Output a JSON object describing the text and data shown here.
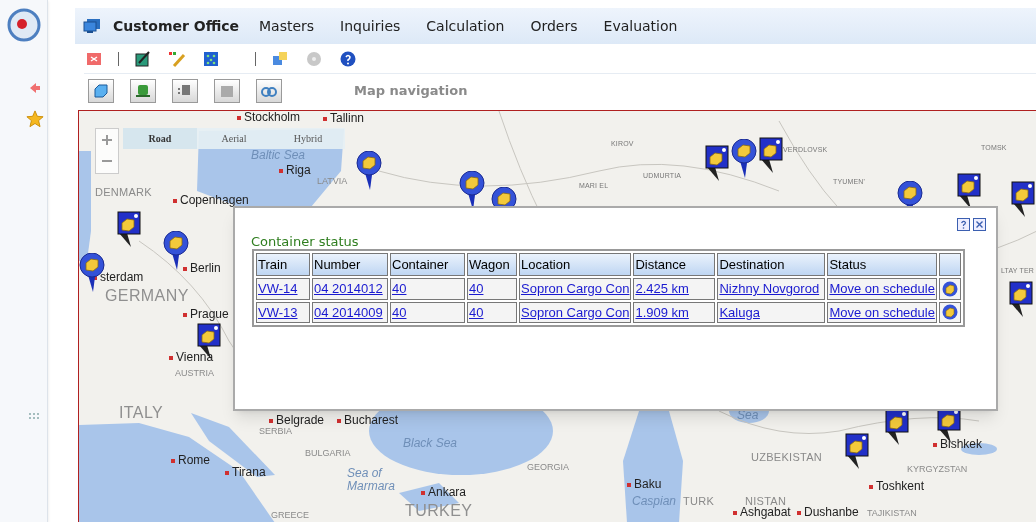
{
  "app": {
    "title": "Customer Office"
  },
  "menu": [
    {
      "label": "Masters"
    },
    {
      "label": "Inquiries"
    },
    {
      "label": "Calculation"
    },
    {
      "label": "Orders"
    },
    {
      "label": "Evaluation"
    }
  ],
  "section_title": "Map navigation",
  "map": {
    "view_modes": [
      {
        "label": "Road",
        "selected": true
      },
      {
        "label": "Aerial",
        "selected": false
      },
      {
        "label": "Hybrid",
        "selected": false
      }
    ],
    "labels": [
      {
        "text": "Stockholm",
        "kind": "city"
      },
      {
        "text": "Tallinn",
        "kind": "city"
      },
      {
        "text": "Baltic Sea",
        "kind": "sea"
      },
      {
        "text": "Riga",
        "kind": "city"
      },
      {
        "text": "LATVIA",
        "kind": "country_small"
      },
      {
        "text": "DENMARK",
        "kind": "country"
      },
      {
        "text": "Copenhagen",
        "kind": "city"
      },
      {
        "text": "sterdam",
        "kind": "city"
      },
      {
        "text": "Berlin",
        "kind": "city"
      },
      {
        "text": "GERMANY",
        "kind": "country_large"
      },
      {
        "text": "Prague",
        "kind": "city"
      },
      {
        "text": "Vienna",
        "kind": "city"
      },
      {
        "text": "AUSTRIA",
        "kind": "country_small"
      },
      {
        "text": "ITALY",
        "kind": "country_large"
      },
      {
        "text": "Belgrade",
        "kind": "city"
      },
      {
        "text": "Bucharest",
        "kind": "city"
      },
      {
        "text": "SERBIA",
        "kind": "country_small"
      },
      {
        "text": "BULGARIA",
        "kind": "country_small"
      },
      {
        "text": "Black Sea",
        "kind": "sea"
      },
      {
        "text": "Rome",
        "kind": "city"
      },
      {
        "text": "Tirana",
        "kind": "city"
      },
      {
        "text": "Sea of Marmara",
        "kind": "sea"
      },
      {
        "text": "Ankara",
        "kind": "city"
      },
      {
        "text": "GREECE",
        "kind": "country_small"
      },
      {
        "text": "TURKEY",
        "kind": "country_large"
      },
      {
        "text": "GEORGIA",
        "kind": "country_small"
      },
      {
        "text": "Baku",
        "kind": "city"
      },
      {
        "text": "Caspian",
        "kind": "sea"
      },
      {
        "text": "Sea",
        "kind": "sea"
      },
      {
        "text": "UZBEKISTAN",
        "kind": "country"
      },
      {
        "text": "TURK",
        "kind": "country"
      },
      {
        "text": "NISTAN",
        "kind": "country"
      },
      {
        "text": "Ashgabat",
        "kind": "city"
      },
      {
        "text": "Dushanbe",
        "kind": "city"
      },
      {
        "text": "TAJIKISTAN",
        "kind": "country_small"
      },
      {
        "text": "Toshkent",
        "kind": "city"
      },
      {
        "text": "Bishkek",
        "kind": "city"
      },
      {
        "text": "KYRGYZSTAN",
        "kind": "country_small"
      },
      {
        "text": "KIROV",
        "kind": "region"
      },
      {
        "text": "MARI EL",
        "kind": "region"
      },
      {
        "text": "UDMURTIA",
        "kind": "region"
      },
      {
        "text": "VERDLOVSK",
        "kind": "region"
      },
      {
        "text": "TYUMEN'",
        "kind": "region"
      },
      {
        "text": "TOMSK",
        "kind": "region"
      },
      {
        "text": "LTAY TER",
        "kind": "region"
      }
    ]
  },
  "popup": {
    "title": "Container status",
    "columns": [
      "Train",
      "Number",
      "Container",
      "Wagon",
      "Location",
      "Distance",
      "Destination",
      "Status"
    ],
    "rows": [
      {
        "cells": [
          "VW-14",
          "04 2014012",
          "40",
          "40",
          "Sopron Cargo Con",
          "2.425 km",
          "Nizhny Novgorod",
          "Move on schedule"
        ]
      },
      {
        "cells": [
          "VW-13",
          "04 2014009",
          "40",
          "40",
          "Sopron Cargo Con",
          "1.909 km",
          "Kaluga",
          "Move on schedule"
        ]
      }
    ]
  }
}
